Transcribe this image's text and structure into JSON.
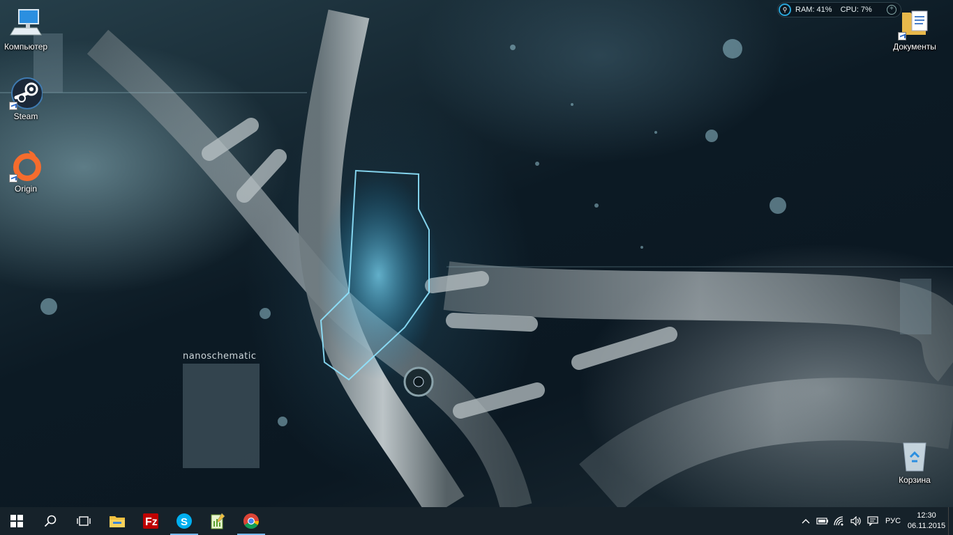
{
  "desktop": {
    "icons": [
      {
        "label": "Компьютер",
        "icon": "computer-icon"
      },
      {
        "label": "Steam",
        "icon": "steam-icon"
      },
      {
        "label": "Origin",
        "icon": "origin-icon"
      },
      {
        "label": "Документы",
        "icon": "documents-folder-icon"
      },
      {
        "label": "Корзина",
        "icon": "recycle-bin-icon"
      }
    ],
    "wallpaper_text": "nanoschematic"
  },
  "widget": {
    "ram": "RAM: 41%",
    "cpu": "CPU: 7%"
  },
  "taskbar": {
    "apps": [
      {
        "name": "file-explorer",
        "icon": "folder-icon",
        "active": false
      },
      {
        "name": "filezilla",
        "icon": "filezilla-icon",
        "active": false
      },
      {
        "name": "skype",
        "icon": "skype-icon",
        "active": true
      },
      {
        "name": "notepad",
        "icon": "notepad-icon",
        "active": false
      },
      {
        "name": "chrome",
        "icon": "chrome-icon",
        "active": true
      }
    ],
    "language": "РУС",
    "time": "12:30",
    "date": "06.11.2015"
  },
  "colors": {
    "taskbar": "#16222a",
    "accent": "#76b9ed",
    "widget_ring": "#2aa5d8"
  }
}
